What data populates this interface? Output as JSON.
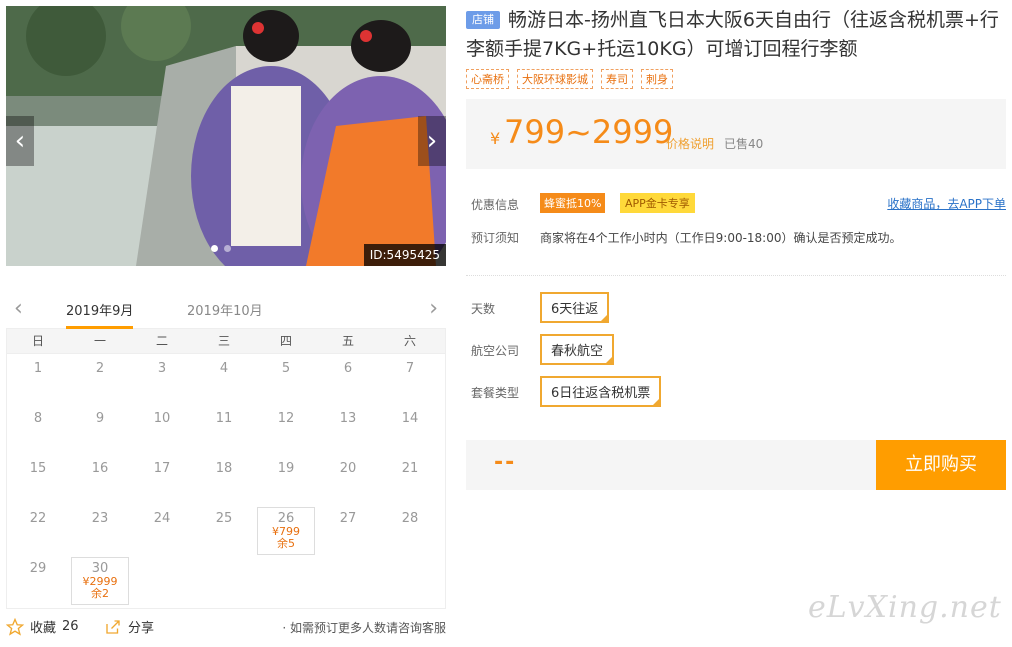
{
  "photo": {
    "id_label": "ID:5495425"
  },
  "calendar": {
    "month1": "2019年9月",
    "month2": "2019年10月",
    "prev": "‹",
    "next": "›",
    "weekdays": [
      "日",
      "一",
      "二",
      "三",
      "四",
      "五",
      "六"
    ],
    "weeks": [
      [
        {
          "d": "1"
        },
        {
          "d": "2"
        },
        {
          "d": "3"
        },
        {
          "d": "4"
        },
        {
          "d": "5"
        },
        {
          "d": "6"
        },
        {
          "d": "7"
        }
      ],
      [
        {
          "d": "8"
        },
        {
          "d": "9"
        },
        {
          "d": "10"
        },
        {
          "d": "11"
        },
        {
          "d": "12"
        },
        {
          "d": "13"
        },
        {
          "d": "14"
        }
      ],
      [
        {
          "d": "15"
        },
        {
          "d": "16"
        },
        {
          "d": "17"
        },
        {
          "d": "18"
        },
        {
          "d": "19"
        },
        {
          "d": "20"
        },
        {
          "d": "21"
        }
      ],
      [
        {
          "d": "22"
        },
        {
          "d": "23"
        },
        {
          "d": "24"
        },
        {
          "d": "25"
        },
        {
          "d": "26",
          "price": "¥799",
          "remain": "余5"
        },
        {
          "d": "27"
        },
        {
          "d": "28"
        }
      ],
      [
        {
          "d": "29"
        },
        {
          "d": "30",
          "price": "¥2999",
          "remain": "余2"
        }
      ]
    ]
  },
  "actions": {
    "fav_label": "收藏",
    "fav_count": "26",
    "share_label": "分享",
    "note": "· 如需预订更多人数请咨询客服"
  },
  "product": {
    "badge": "店铺",
    "title": "畅游日本-扬州直飞日本大阪6天自由行（往返含税机票+行李额手提7KG+托运10KG）可增订回程行李额",
    "tags": [
      "心斋桥",
      "大阪环球影城",
      "寿司",
      "刺身"
    ],
    "price_symbol": "¥",
    "price": "799~2999",
    "price_explain": "价格说明",
    "sold": "已售40"
  },
  "promo": {
    "label": "优惠信息",
    "badge1": "蜂蜜抵10%",
    "badge2": "APP金卡专享",
    "fav_link": "收藏商品，去APP下单"
  },
  "booking": {
    "label": "预订须知",
    "text": "商家将在4个工作小时内（工作日9:00-18:00）确认是否预定成功。"
  },
  "options": [
    {
      "label": "天数",
      "value": "6天往返"
    },
    {
      "label": "航空公司",
      "value": "春秋航空"
    },
    {
      "label": "套餐类型",
      "value": "6日往返含税机票"
    }
  ],
  "buy": {
    "placeholder": "--",
    "button": "立即购买"
  },
  "watermark": "eLvXing.net",
  "colors": {
    "accent": "#ff9d00",
    "price": "#f58b19",
    "link": "#2a72c8",
    "badge": "#6d9ce8"
  }
}
